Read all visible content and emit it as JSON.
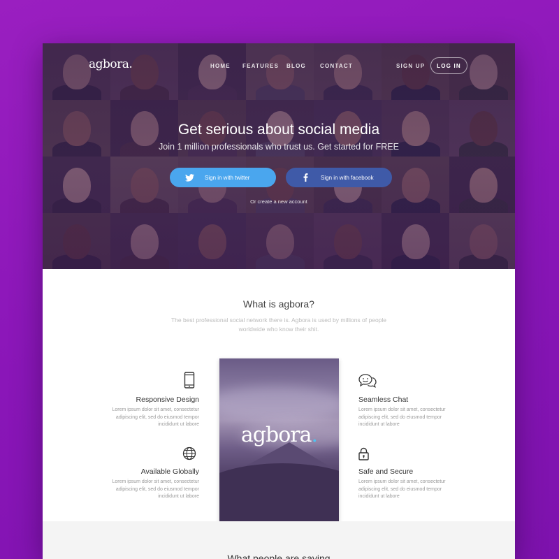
{
  "nav": {
    "logo": "agbora.",
    "links": [
      {
        "label": "HOME",
        "active": true
      },
      {
        "label": "FEATURES",
        "active": false
      },
      {
        "label": "BLOG",
        "active": true
      },
      {
        "label": "CONTACT",
        "active": false
      }
    ],
    "signup": "SIGN UP",
    "login": "LOG IN"
  },
  "hero": {
    "title": "Get serious about social media",
    "subtitle": "Join 1 million professionals who trust us. Get started for FREE",
    "twitter_button": "Sign in with twitter",
    "facebook_button": "Sign in with facebook",
    "create_account": "Or create a new account"
  },
  "about": {
    "title": "What is agbora?",
    "description": "The best professional social network there is. Agbora is used by millions of people worldwide who know their shit.",
    "phone_logo": "agbora",
    "phone_logo_dot": "."
  },
  "features": [
    {
      "title": "Responsive Design",
      "icon": "smartphone-icon",
      "description": "Lorem ipsum dolor sit amet, consectetur adipiscing elit, sed do eiusmod tempor incididunt ut labore"
    },
    {
      "title": "Seamless Chat",
      "icon": "chat-bubbles-icon",
      "description": "Lorem ipsum dolor sit amet, consectetur adipiscing elit, sed do eiusmod tempor incididunt ut labore"
    },
    {
      "title": "Available Globally",
      "icon": "globe-icon",
      "description": "Lorem ipsum dolor sit amet, consectetur adipiscing elit, sed do eiusmod tempor incididunt ut labore"
    },
    {
      "title": "Safe and Secure",
      "icon": "lock-icon",
      "description": "Lorem ipsum dolor sit amet, consectetur adipiscing elit, sed do eiusmod tempor incididunt ut labore"
    }
  ],
  "testimonials": {
    "title": "What people are saying"
  },
  "colors": {
    "background": "#8a16b8",
    "twitter": "#4aa6ee",
    "facebook": "#3f5aa8",
    "accent_dot": "#4ec3f0"
  }
}
